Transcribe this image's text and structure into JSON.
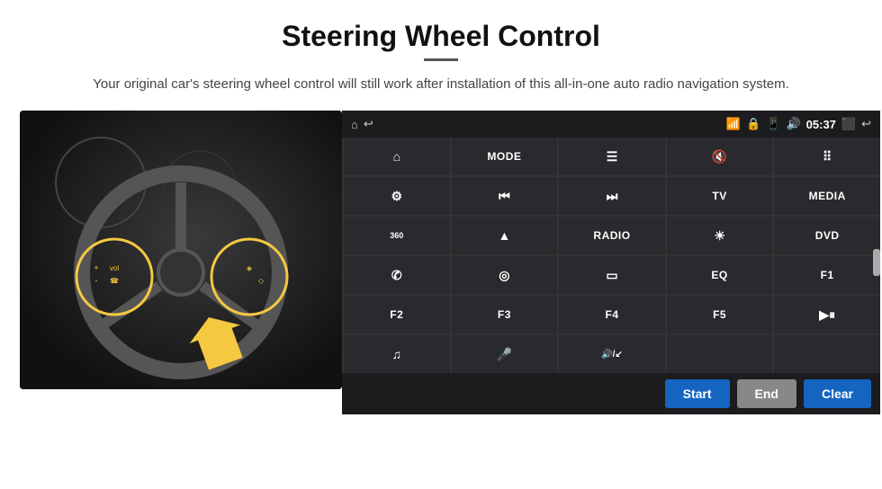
{
  "page": {
    "title": "Steering Wheel Control",
    "subtitle": "Your original car's steering wheel control will still work after installation of this all-in-one auto radio navigation system.",
    "divider": true
  },
  "statusBar": {
    "time": "05:37",
    "icons": [
      "home",
      "wifi",
      "lock",
      "sim",
      "bluetooth",
      "cast",
      "back"
    ]
  },
  "grid": [
    {
      "id": "r1c1",
      "type": "icon",
      "icon": "⌂"
    },
    {
      "id": "r1c2",
      "type": "text",
      "label": "MODE"
    },
    {
      "id": "r1c3",
      "type": "icon",
      "icon": "☰"
    },
    {
      "id": "r1c4",
      "type": "icon",
      "icon": "🔇"
    },
    {
      "id": "r1c5",
      "type": "icon",
      "icon": "⠿"
    },
    {
      "id": "r2c1",
      "type": "icon",
      "icon": "⚙"
    },
    {
      "id": "r2c2",
      "type": "icon",
      "icon": "⏮"
    },
    {
      "id": "r2c3",
      "type": "icon",
      "icon": "⏭"
    },
    {
      "id": "r2c4",
      "type": "text",
      "label": "TV"
    },
    {
      "id": "r2c5",
      "type": "text",
      "label": "MEDIA"
    },
    {
      "id": "r3c1",
      "type": "icon",
      "icon": "360"
    },
    {
      "id": "r3c2",
      "type": "icon",
      "icon": "▲"
    },
    {
      "id": "r3c3",
      "type": "text",
      "label": "RADIO"
    },
    {
      "id": "r3c4",
      "type": "icon",
      "icon": "☀"
    },
    {
      "id": "r3c5",
      "type": "text",
      "label": "DVD"
    },
    {
      "id": "r4c1",
      "type": "icon",
      "icon": "✆"
    },
    {
      "id": "r4c2",
      "type": "icon",
      "icon": "◎"
    },
    {
      "id": "r4c3",
      "type": "icon",
      "icon": "▭"
    },
    {
      "id": "r4c4",
      "type": "text",
      "label": "EQ"
    },
    {
      "id": "r4c5",
      "type": "text",
      "label": "F1"
    },
    {
      "id": "r5c1",
      "type": "text",
      "label": "F2"
    },
    {
      "id": "r5c2",
      "type": "text",
      "label": "F3"
    },
    {
      "id": "r5c3",
      "type": "text",
      "label": "F4"
    },
    {
      "id": "r5c4",
      "type": "text",
      "label": "F5"
    },
    {
      "id": "r5c5",
      "type": "icon",
      "icon": "▶⏸"
    },
    {
      "id": "r6c1",
      "type": "icon",
      "icon": "♫"
    },
    {
      "id": "r6c2",
      "type": "icon",
      "icon": "🎤"
    },
    {
      "id": "r6c3",
      "type": "icon",
      "icon": "🔊/↙"
    },
    {
      "id": "r6c4",
      "type": "empty",
      "label": ""
    },
    {
      "id": "r6c5",
      "type": "empty",
      "label": ""
    }
  ],
  "bottomBar": {
    "startLabel": "Start",
    "endLabel": "End",
    "clearLabel": "Clear"
  }
}
